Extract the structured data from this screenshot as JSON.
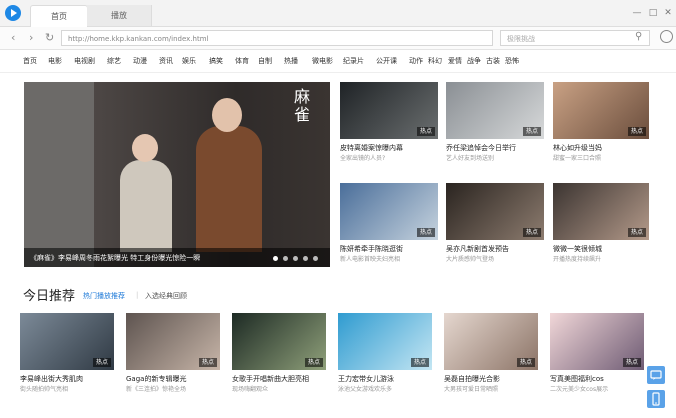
{
  "tabs": [
    {
      "label": "首页"
    },
    {
      "label": "播放"
    }
  ],
  "window_controls": {
    "minimize": "—",
    "restore": "□",
    "close": "✕"
  },
  "address": {
    "url": "http://home.kkp.kankan.com/index.html",
    "search_placeholder": "极限挑战"
  },
  "nav_categories": [
    "首页",
    "电影",
    "电视剧",
    "综艺",
    "动漫",
    "资讯",
    "娱乐",
    "搞笑",
    "体育",
    "自制",
    "热播",
    "微电影",
    "纪录片",
    "公开课",
    "动作",
    "科幻",
    "爱情",
    "战争",
    "古装",
    "恐怖"
  ],
  "hero": {
    "caption": "《麻雀》李易峰周冬雨花絮曝光 特工身份曝光惊险一瞬",
    "art_title": "麻雀",
    "slides": 5,
    "active_slide": 0
  },
  "badge_label": "热点",
  "top_grid": [
    {
      "title": "皮特离婚案惊曝内幕",
      "sub": "全家出镜的人员?"
    },
    {
      "title": "乔任梁追悼会今日举行",
      "sub": "艺人好友到场送别"
    },
    {
      "title": "林心如升级当妈",
      "sub": "甜蜜一家三口合照"
    },
    {
      "title": "陈妍希牵手陈晓逛街",
      "sub": "新人电影首映夫妇亮相"
    },
    {
      "title": "吴亦凡新剧首发预告",
      "sub": "大片质感帅气登场"
    },
    {
      "title": "微微一笑很倾城",
      "sub": "开播热度持续飙升"
    }
  ],
  "section": {
    "title": "今日推荐",
    "tag_active": "热门播放推荐",
    "tag_2": "入选经典回顾"
  },
  "bottom_row": [
    {
      "title": "李易峰出街大秀肌肉",
      "sub": "街头随拍帅气亮相"
    },
    {
      "title": "Gaga的新专辑曝光",
      "sub": "新《三连拍》惊艳全场"
    },
    {
      "title": "女歌手开唱新曲大胆亮相",
      "sub": "现场嗨翻观众"
    },
    {
      "title": "王力宏带女儿游泳",
      "sub": "泳池父女游戏欢乐多"
    },
    {
      "title": "吴磊自拍曝光合影",
      "sub": "大男孩可爱日常晒照"
    },
    {
      "title": "写真美图福利cos",
      "sub": "二次元美少女cos展示"
    }
  ],
  "colors": {
    "accent": "#1e7ad8",
    "tab_bar": "#f3f3f3",
    "side_button": "#5aa2e8"
  },
  "icons": {
    "logo": "play-logo-icon",
    "back": "chevron-left-icon",
    "forward": "chevron-right-icon",
    "refresh": "refresh-icon",
    "search": "search-icon",
    "chat": "chat-icon",
    "mobile": "mobile-icon"
  }
}
